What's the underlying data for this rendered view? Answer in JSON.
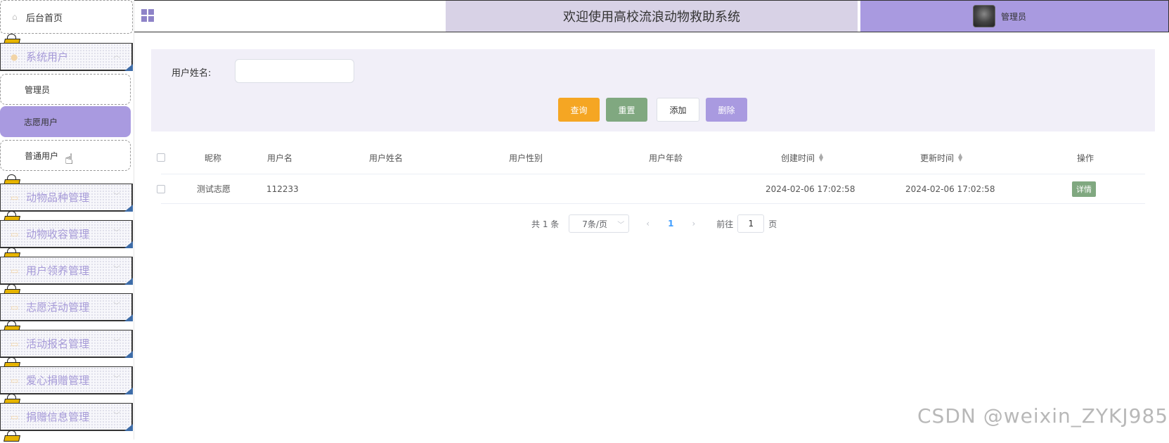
{
  "sidebar": {
    "home_label": "后台首页",
    "groups": [
      {
        "label": "系统用户",
        "children": [
          "管理员",
          "志愿用户",
          "普通用户"
        ]
      },
      {
        "label": "动物品种管理"
      },
      {
        "label": "动物收容管理"
      },
      {
        "label": "用户领养管理"
      },
      {
        "label": "志愿活动管理"
      },
      {
        "label": "活动报名管理"
      },
      {
        "label": "爱心捐赠管理"
      },
      {
        "label": "捐赠信息管理"
      }
    ],
    "active_item": "志愿用户"
  },
  "header": {
    "title": "欢迎使用高校流浪动物救助系统",
    "user_label": "管理员"
  },
  "search": {
    "label": "用户姓名:",
    "value": "",
    "buttons": {
      "query": "查询",
      "reset": "重置",
      "add": "添加",
      "delete": "删除"
    }
  },
  "table": {
    "columns": [
      "昵称",
      "用户名",
      "用户姓名",
      "用户性别",
      "用户年龄",
      "创建时间",
      "更新时间",
      "操作"
    ],
    "rows": [
      {
        "nickname": "测试志愿",
        "username": "112233",
        "name": "",
        "gender": "",
        "age": "",
        "created": "2024-02-06 17:02:58",
        "updated": "2024-02-06 17:02:58",
        "action": "详情"
      }
    ]
  },
  "pagination": {
    "total": "共 1 条",
    "page_size": "7条/页",
    "current_page": "1",
    "goto_label": "前往",
    "goto_value": "1",
    "page_suffix": "页"
  },
  "watermark": "CSDN @weixin_ZYKJ985",
  "colors": {
    "accent": "#a99ae0",
    "query": "#f5a623",
    "reset": "#80a880",
    "title_band": "#d8d2e6"
  }
}
